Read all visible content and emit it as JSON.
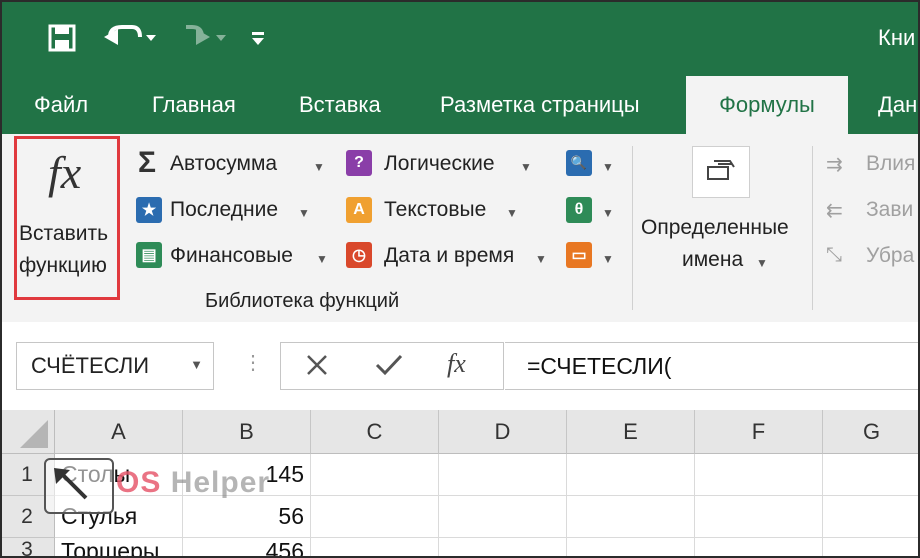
{
  "window": {
    "title": "Кни"
  },
  "tabs": [
    {
      "label": "Файл"
    },
    {
      "label": "Главная"
    },
    {
      "label": "Вставка"
    },
    {
      "label": "Разметка страницы"
    },
    {
      "label": "Формулы"
    },
    {
      "label": "Дан"
    }
  ],
  "ribbon": {
    "insert_function": {
      "line1": "Вставить",
      "line2": "функцию",
      "icon_text": "fx"
    },
    "library": {
      "col1": [
        {
          "label": "Автосумма",
          "icon": "Σ"
        },
        {
          "label": "Последние",
          "icon": "★"
        },
        {
          "label": "Финансовые",
          "icon": "▤"
        }
      ],
      "col2": [
        {
          "label": "Логические",
          "icon": "?"
        },
        {
          "label": "Текстовые",
          "icon": "A"
        },
        {
          "label": "Дата и время",
          "icon": "◷"
        }
      ],
      "col3_icons": [
        "🔍",
        "θ",
        "▭"
      ],
      "group_label": "Библиотека функций"
    },
    "defined_names": {
      "line1": "Определенные",
      "line2": "имена"
    },
    "audit": [
      "Влия",
      "Зави",
      "Убра"
    ]
  },
  "formula_bar": {
    "name_box": "СЧЁТЕСЛИ",
    "formula": "=СЧЕТЕСЛИ(",
    "fx": "fx"
  },
  "sheet": {
    "columns": [
      "A",
      "B",
      "C",
      "D",
      "E",
      "F",
      "G"
    ],
    "rows": [
      {
        "num": "1",
        "a": "Столы",
        "b": "145"
      },
      {
        "num": "2",
        "a": "Стулья",
        "b": "56"
      },
      {
        "num": "3",
        "a": "Торшеры",
        "b": "456"
      }
    ]
  },
  "watermark": {
    "os": "OS",
    "helper": "Helper"
  },
  "colors": {
    "excel_green": "#217346",
    "highlight_red": "#e0393e",
    "ribbon_bg": "#f3f3f3"
  }
}
